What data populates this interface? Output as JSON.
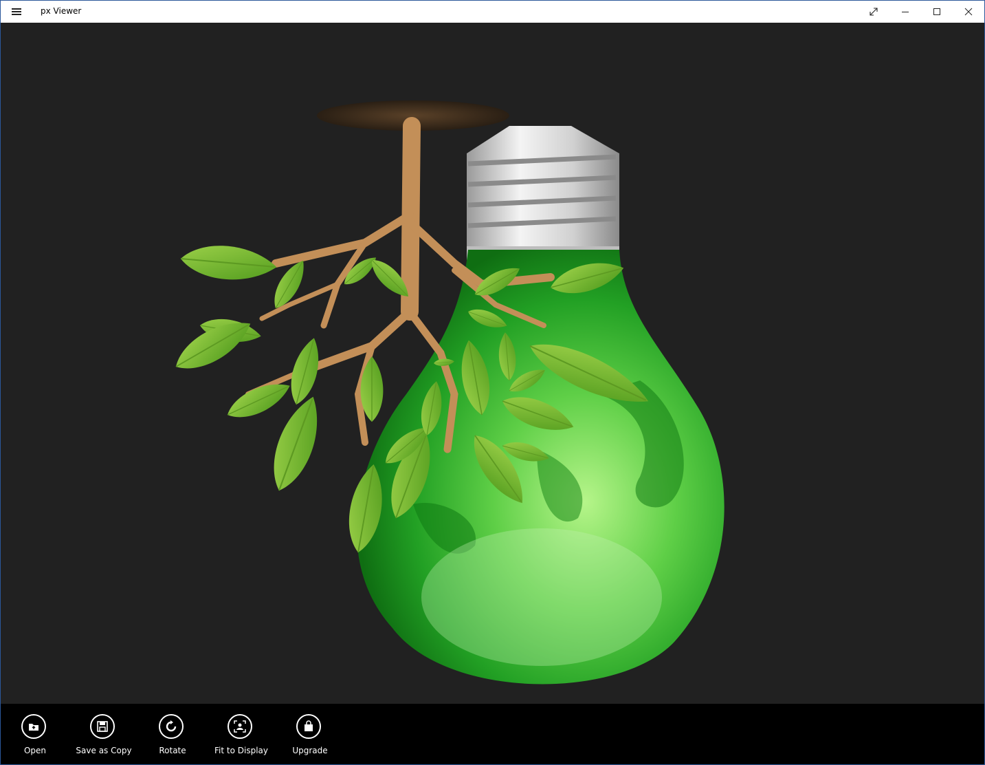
{
  "window": {
    "title": "px Viewer"
  },
  "titlebar": {
    "icons": [
      "hamburger-menu-icon",
      "fullscreen-icon",
      "minimize-icon",
      "maximize-icon",
      "close-icon"
    ]
  },
  "appbar": {
    "buttons": [
      {
        "label": "Open",
        "icon": "open-folder-icon"
      },
      {
        "label": "Save as Copy",
        "icon": "save-icon"
      },
      {
        "label": "Rotate",
        "icon": "rotate-icon"
      },
      {
        "label": "Fit to Display",
        "icon": "fit-to-display-icon"
      },
      {
        "label": "Upgrade",
        "icon": "shopping-bag-icon"
      }
    ]
  },
  "colors": {
    "titlebar_bg": "#ffffff",
    "viewer_bg": "#212121",
    "appbar_bg": "#000000",
    "bulb_green": "#1e8c1e",
    "leaf_green": "#7bbf2a",
    "branch_brown": "#c9955e"
  }
}
